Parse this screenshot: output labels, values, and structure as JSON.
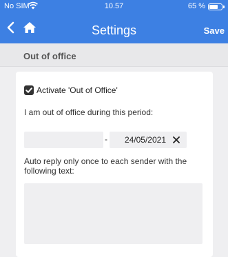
{
  "status_bar": {
    "carrier": "No SIM",
    "time": "10.57",
    "battery_text": "65 %",
    "battery_level": 0.65
  },
  "nav": {
    "title": "Settings",
    "save_label": "Save",
    "back_icon": "chevron-left-icon",
    "home_icon": "home-icon"
  },
  "section": {
    "title": "Out of office"
  },
  "form": {
    "activate_label": "Activate 'Out of Office'",
    "activate_checked": true,
    "period_label": "I am out of office during this period:",
    "date_from_value": "",
    "date_separator": "-",
    "date_to_value": "24/05/2021",
    "reply_label": "Auto reply only once to each sender with the following text:",
    "reply_text": ""
  },
  "colors": {
    "accent": "#3d80e3",
    "background": "#efeff1",
    "card": "#ffffff"
  }
}
